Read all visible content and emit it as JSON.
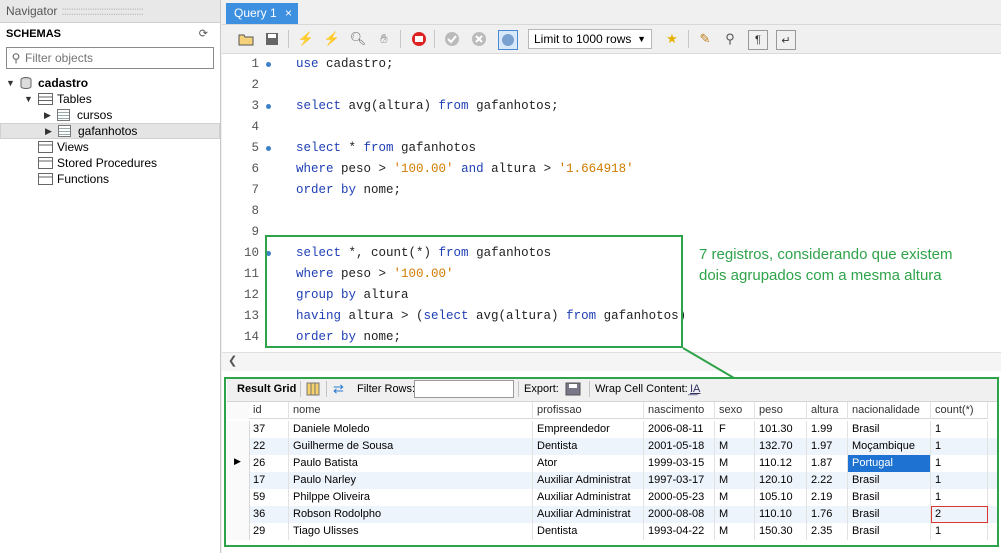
{
  "navigator": {
    "title": "Navigator",
    "schemas_label": "SCHEMAS",
    "filter_placeholder": "Filter objects",
    "tree": {
      "schema": "cadastro",
      "tables_label": "Tables",
      "tables": [
        "cursos",
        "gafanhotos"
      ],
      "views_label": "Views",
      "procedures_label": "Stored Procedures",
      "functions_label": "Functions"
    }
  },
  "tab": {
    "label": "Query 1",
    "close": "×"
  },
  "toolbar": {
    "limit_label": "Limit to 1000 rows",
    "icons": [
      "open-file-icon",
      "save-icon",
      "execute-icon",
      "execute-current-icon",
      "explain-icon",
      "stop-icon",
      "toggle-output-icon",
      "commit-icon",
      "rollback-icon",
      "autocommit-icon",
      "bookmark-icon",
      "beautify-icon",
      "find-icon",
      "invisible-chars-icon",
      "wrap-icon"
    ]
  },
  "editor": {
    "lines": [
      {
        "n": "1",
        "bullet": true,
        "tokens": [
          {
            "t": "kw",
            "v": "use"
          },
          {
            "t": "id",
            "v": " cadastro;"
          }
        ]
      },
      {
        "n": "2",
        "bullet": false,
        "tokens": []
      },
      {
        "n": "3",
        "bullet": true,
        "tokens": [
          {
            "t": "kw",
            "v": "select"
          },
          {
            "t": "id",
            "v": " avg(altura) "
          },
          {
            "t": "kw",
            "v": "from"
          },
          {
            "t": "id",
            "v": " gafanhotos;"
          }
        ]
      },
      {
        "n": "4",
        "bullet": false,
        "tokens": []
      },
      {
        "n": "5",
        "bullet": true,
        "tokens": [
          {
            "t": "kw",
            "v": "select"
          },
          {
            "t": "id",
            "v": " * "
          },
          {
            "t": "kw",
            "v": "from"
          },
          {
            "t": "id",
            "v": " gafanhotos"
          }
        ]
      },
      {
        "n": "6",
        "bullet": false,
        "tokens": [
          {
            "t": "kw",
            "v": "where"
          },
          {
            "t": "id",
            "v": " peso > "
          },
          {
            "t": "str",
            "v": "'100.00'"
          },
          {
            "t": "id",
            "v": " "
          },
          {
            "t": "kw",
            "v": "and"
          },
          {
            "t": "id",
            "v": " altura > "
          },
          {
            "t": "str",
            "v": "'1.664918'"
          }
        ]
      },
      {
        "n": "7",
        "bullet": false,
        "tokens": [
          {
            "t": "kw",
            "v": "order by"
          },
          {
            "t": "id",
            "v": " nome;"
          }
        ]
      },
      {
        "n": "8",
        "bullet": false,
        "tokens": []
      },
      {
        "n": "9",
        "bullet": false,
        "tokens": []
      },
      {
        "n": "10",
        "bullet": true,
        "tokens": [
          {
            "t": "kw",
            "v": "select"
          },
          {
            "t": "id",
            "v": " *, count(*) "
          },
          {
            "t": "kw",
            "v": "from"
          },
          {
            "t": "id",
            "v": " gafanhotos"
          }
        ]
      },
      {
        "n": "11",
        "bullet": false,
        "tokens": [
          {
            "t": "kw",
            "v": "where"
          },
          {
            "t": "id",
            "v": " peso > "
          },
          {
            "t": "str",
            "v": "'100.00'"
          }
        ]
      },
      {
        "n": "12",
        "bullet": false,
        "tokens": [
          {
            "t": "kw",
            "v": "group by"
          },
          {
            "t": "id",
            "v": " altura"
          }
        ]
      },
      {
        "n": "13",
        "bullet": false,
        "tokens": [
          {
            "t": "kw",
            "v": "having"
          },
          {
            "t": "id",
            "v": " altura > ("
          },
          {
            "t": "kw",
            "v": "select"
          },
          {
            "t": "id",
            "v": " avg(altura) "
          },
          {
            "t": "kw",
            "v": "from"
          },
          {
            "t": "id",
            "v": " gafanhotos)"
          }
        ]
      },
      {
        "n": "14",
        "bullet": false,
        "tokens": [
          {
            "t": "kw",
            "v": "order by"
          },
          {
            "t": "id",
            "v": " nome;"
          }
        ]
      }
    ]
  },
  "annotation": {
    "line1": "7 registros, considerando que existem",
    "line2": "dois agrupados com a mesma altura",
    "color": "#2fa34a"
  },
  "result_bar": {
    "result_grid": "Result Grid",
    "filter_rows": "Filter Rows:",
    "export": "Export:",
    "wrap": "Wrap Cell Content:"
  },
  "grid": {
    "columns": [
      "id",
      "nome",
      "profissao",
      "nascimento",
      "sexo",
      "peso",
      "altura",
      "nacionalidade",
      "count(*)"
    ],
    "rows": [
      [
        "37",
        "Daniele Moledo",
        "Empreendedor",
        "2006-08-11",
        "F",
        "101.30",
        "1.99",
        "Brasil",
        "1"
      ],
      [
        "22",
        "Guilherme de Sousa",
        "Dentista",
        "2001-05-18",
        "M",
        "132.70",
        "1.97",
        "Moçambique",
        "1"
      ],
      [
        "26",
        "Paulo Batista",
        "Ator",
        "1999-03-15",
        "M",
        "110.12",
        "1.87",
        "Portugal",
        "1"
      ],
      [
        "17",
        "Paulo Narley",
        "Auxiliar Administrat",
        "1997-03-17",
        "M",
        "120.10",
        "2.22",
        "Brasil",
        "1"
      ],
      [
        "59",
        "Philppe Oliveira",
        "Auxiliar Administrat",
        "2000-05-23",
        "M",
        "105.10",
        "2.19",
        "Brasil",
        "1"
      ],
      [
        "36",
        "Robson Rodolpho",
        "Auxiliar Administrat",
        "2000-08-08",
        "M",
        "110.10",
        "1.76",
        "Brasil",
        "2"
      ],
      [
        "29",
        "Tiago Ulisses",
        "Dentista",
        "1993-04-22",
        "M",
        "150.30",
        "2.35",
        "Brasil",
        "1"
      ]
    ],
    "current_row": 2,
    "selected_cell": [
      2,
      7
    ],
    "highlighted_cell": [
      5,
      8
    ]
  }
}
